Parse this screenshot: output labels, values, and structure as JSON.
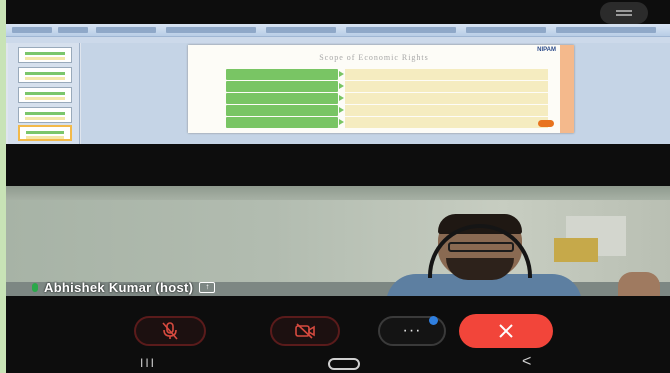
{
  "window": {
    "menu_icon": "menu-icon"
  },
  "shared_screen": {
    "slide_title": "Scope of Economic Rights",
    "slide_logo": "NIPAM",
    "rows": [
      {
        "left": "",
        "right": ""
      },
      {
        "left": "",
        "right": ""
      },
      {
        "left": "",
        "right": ""
      },
      {
        "left": "",
        "right": ""
      },
      {
        "left": "",
        "right": ""
      }
    ]
  },
  "participant": {
    "name": "Abhishek Kumar (host)",
    "mic_status_icon": "mic-on-icon",
    "share_icon": "share-screen-icon"
  },
  "controls": {
    "mute_icon": "mic-off-icon",
    "video_icon": "video-off-icon",
    "more_label": "···",
    "end_icon": "close-icon"
  },
  "navigation": {
    "recents_label": "III",
    "home_icon": "home-icon",
    "back_label": "<"
  },
  "colors": {
    "end_call": "#f2453a",
    "muted_outline": "#5a1b1b",
    "notification_dot": "#2f7fe0",
    "slide_green": "#79c564",
    "slide_yellow": "#f5ecc0"
  }
}
